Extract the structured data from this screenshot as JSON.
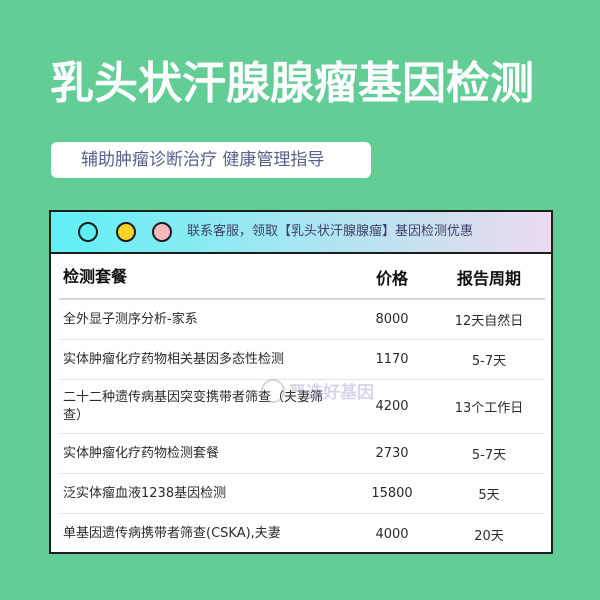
{
  "header": {
    "title": "乳头状汗腺腺瘤基因检测",
    "subtitle": "辅助肿瘤诊断治疗 健康管理指导"
  },
  "window": {
    "bar_text": "联系客服，领取【乳头状汗腺腺瘤】基因检测优惠",
    "dot_colors": [
      "#5feef2",
      "#f6d22b",
      "#f5b8bf"
    ]
  },
  "table": {
    "columns": [
      "检测套餐",
      "价格",
      "报告周期"
    ],
    "rows": [
      {
        "name": "全外显子测序分析-家系",
        "price": "8000",
        "period": "12天自然日"
      },
      {
        "name": "实体肿瘤化疗药物相关基因多态性检测",
        "price": "1170",
        "period": "5-7天"
      },
      {
        "name": "二十二种遗传病基因突变携带者筛查（夫妻筛查）",
        "price": "4200",
        "period": "13个工作日"
      },
      {
        "name": "实体肿瘤化疗药物检测套餐",
        "price": "2730",
        "period": "5-7天"
      },
      {
        "name": "泛实体瘤血液1238基因检测",
        "price": "15800",
        "period": "5天"
      },
      {
        "name": "单基因遗传病携带者筛查(CSKA),夫妻",
        "price": "4000",
        "period": "20天"
      }
    ]
  },
  "watermark": {
    "text": "严选好基因",
    "icon": "logo-circle-icon"
  },
  "colors": {
    "background": "#63cd96",
    "title": "#ffffff",
    "subtitle_text": "#5a5f8c"
  }
}
